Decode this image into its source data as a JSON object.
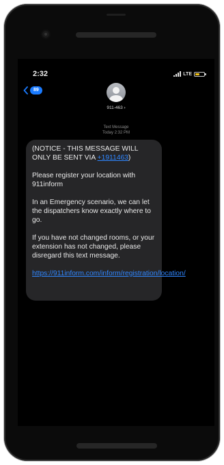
{
  "status_bar": {
    "time": "2:32",
    "network": "LTE"
  },
  "header": {
    "back_count": "89",
    "contact": "911-463 ›"
  },
  "thread": {
    "label": "Text Message",
    "timestamp": "Today 2:32 PM"
  },
  "message": {
    "notice_prefix": "(NOTICE - THIS MESSAGE WILL ONLY BE SENT VIA ",
    "notice_number": "+1911463",
    "notice_suffix": ")",
    "para2": "Please register your location with 911inform",
    "para3": "In an Emergency scenario, we can let the dispatchers know exactly where to go.",
    "para4": "If you have not changed rooms, or your extension has not changed, please disregard this text message.",
    "link": "https://911inform.com/inform/registration/location/"
  },
  "colors": {
    "link": "#2f86ff",
    "bubble": "#262628",
    "badge": "#1a7bff",
    "battery": "#f5c518"
  }
}
